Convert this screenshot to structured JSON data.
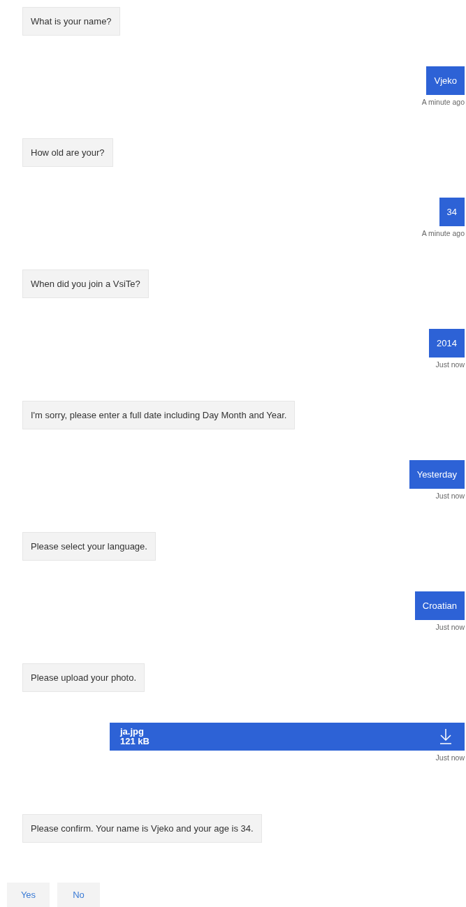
{
  "messages": [
    {
      "kind": "bot",
      "text": "What is your name?"
    },
    {
      "kind": "user",
      "text": "Vjeko",
      "time": "A minute ago"
    },
    {
      "kind": "bot",
      "text": "How old are your?"
    },
    {
      "kind": "user",
      "text": "34",
      "time": "A minute ago"
    },
    {
      "kind": "bot",
      "text": "When did you join a VsiTe?"
    },
    {
      "kind": "user",
      "text": "2014",
      "time": "Just now"
    },
    {
      "kind": "bot",
      "text": "I'm sorry, please enter a full date including Day Month and Year."
    },
    {
      "kind": "user",
      "text": "Yesterday",
      "time": "Just now"
    },
    {
      "kind": "bot",
      "text": "Please select your language."
    },
    {
      "kind": "user",
      "text": "Croatian",
      "time": "Just now"
    },
    {
      "kind": "bot",
      "text": "Please upload your photo."
    },
    {
      "kind": "file",
      "name": "ja.jpg",
      "size": "121 kB",
      "time": "Just now"
    },
    {
      "kind": "bot",
      "text": "Please confirm. Your name is Vjeko and your age is 34."
    }
  ],
  "buttons": [
    "Yes",
    "No"
  ]
}
